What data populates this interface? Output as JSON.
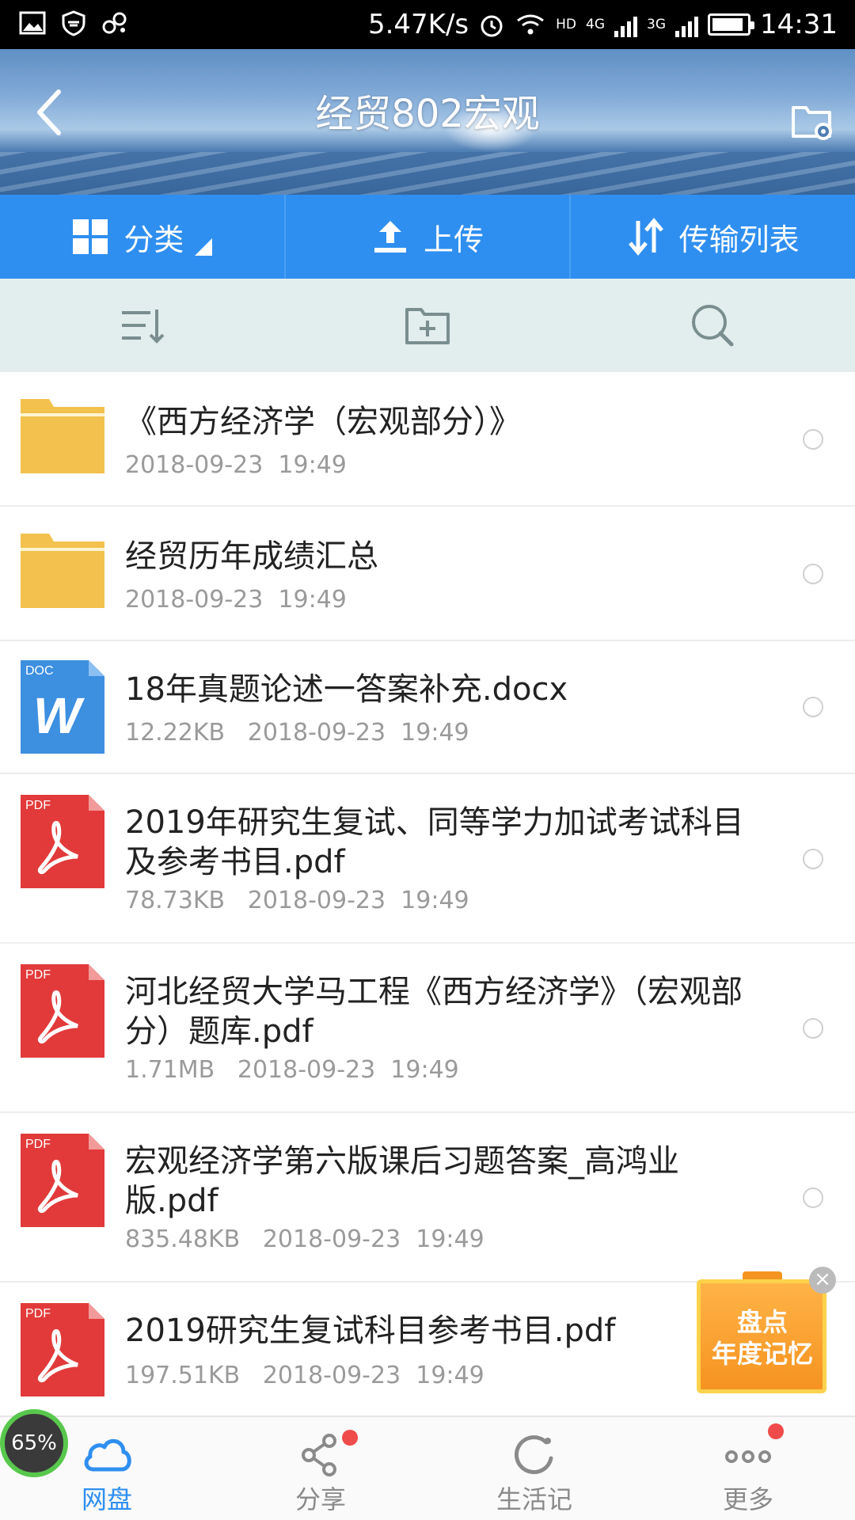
{
  "status_bar": {
    "speed": "5.47K/s",
    "network_hd": "HD",
    "network_4g": "4G",
    "network_3g": "3G",
    "time": "14:31"
  },
  "header": {
    "title": "经贸802宏观"
  },
  "actions": [
    {
      "label": "分类",
      "icon": "grid-icon"
    },
    {
      "label": "上传",
      "icon": "upload-icon"
    },
    {
      "label": "传输列表",
      "icon": "transfer-icon"
    }
  ],
  "toolbar": {
    "icons": [
      "sort-icon",
      "new-folder-icon",
      "search-icon"
    ]
  },
  "files": [
    {
      "type": "folder",
      "name": "《西方经济学（宏观部分）》",
      "meta": "2018-09-23  19:49"
    },
    {
      "type": "folder",
      "name": "经贸历年成绩汇总",
      "meta": "2018-09-23  19:49"
    },
    {
      "type": "doc",
      "badge": "DOC",
      "name": "18年真题论述一答案补充.docx",
      "meta": "12.22KB   2018-09-23  19:49"
    },
    {
      "type": "pdf",
      "badge": "PDF",
      "name": "2019年研究生复试、同等学力加试考试科目及参考书目.pdf",
      "meta": "78.73KB   2018-09-23  19:49"
    },
    {
      "type": "pdf",
      "badge": "PDF",
      "name": "河北经贸大学马工程《西方经济学》（宏观部分）题库.pdf",
      "meta": "1.71MB   2018-09-23  19:49"
    },
    {
      "type": "pdf",
      "badge": "PDF",
      "name": "宏观经济学第六版课后习题答案_高鸿业版.pdf",
      "meta": "835.48KB   2018-09-23  19:49"
    },
    {
      "type": "pdf",
      "badge": "PDF",
      "name": "2019研究生复试科目参考书目.pdf",
      "meta": "197.51KB   2018-09-23  19:49"
    }
  ],
  "promo": {
    "line1": "盘点",
    "line2": "年度记忆",
    "close": "×"
  },
  "speed_widget": "65%",
  "nav": [
    {
      "label": "网盘",
      "icon": "cloud-icon",
      "active": true
    },
    {
      "label": "分享",
      "icon": "share-icon",
      "badge": true
    },
    {
      "label": "生活记",
      "icon": "life-record-icon"
    },
    {
      "label": "更多",
      "icon": "more-icon",
      "badge": true
    }
  ],
  "colors": {
    "primary": "#2f8ff0",
    "folder": "#f2c14e",
    "pdf": "#e23a3a",
    "doc": "#3d8fe0"
  }
}
